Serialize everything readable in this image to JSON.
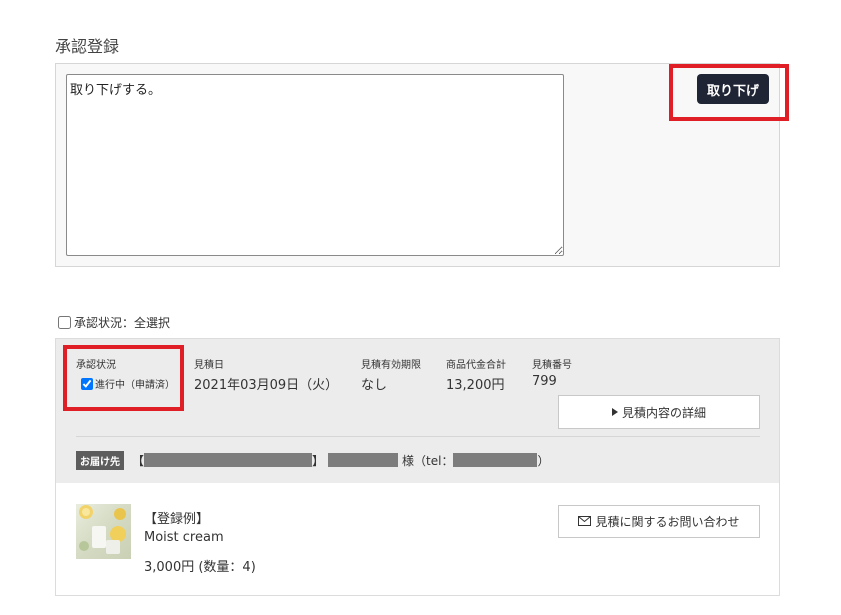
{
  "approval": {
    "title": "承認登録",
    "comment_value": "取り下げする。",
    "withdraw_label": "取り下げ"
  },
  "select_all": {
    "label": "承認状況：全選択",
    "checked": false
  },
  "order": {
    "columns": [
      {
        "label": "承認状況"
      },
      {
        "label": "見積日",
        "value": "2021年03月09日（火）"
      },
      {
        "label": "見積有効期限",
        "value": "なし"
      },
      {
        "label": "商品代金合計",
        "value": "13,200円"
      },
      {
        "label": "見積番号",
        "value": "799"
      }
    ],
    "status_value": "進行中（申請済）",
    "status_checked": true,
    "detail_button_label": "見積内容の詳細",
    "shipping": {
      "badge": "お届け先",
      "bracket_open": "【",
      "bracket_close": "】",
      "honorific": "様（tel：",
      "paren_close": "）"
    },
    "product": {
      "name": "【登録例】",
      "subtitle": "Moist cream",
      "price_qty": "3,000円 (数量：4)"
    },
    "inquiry_button_label": "見積に関するお問い合わせ"
  },
  "colors": {
    "accent_button": "#1f2535",
    "highlight_frame": "#e01e25"
  },
  "icons": {
    "detail": "caret-right-icon",
    "inquiry": "envelope-icon"
  }
}
